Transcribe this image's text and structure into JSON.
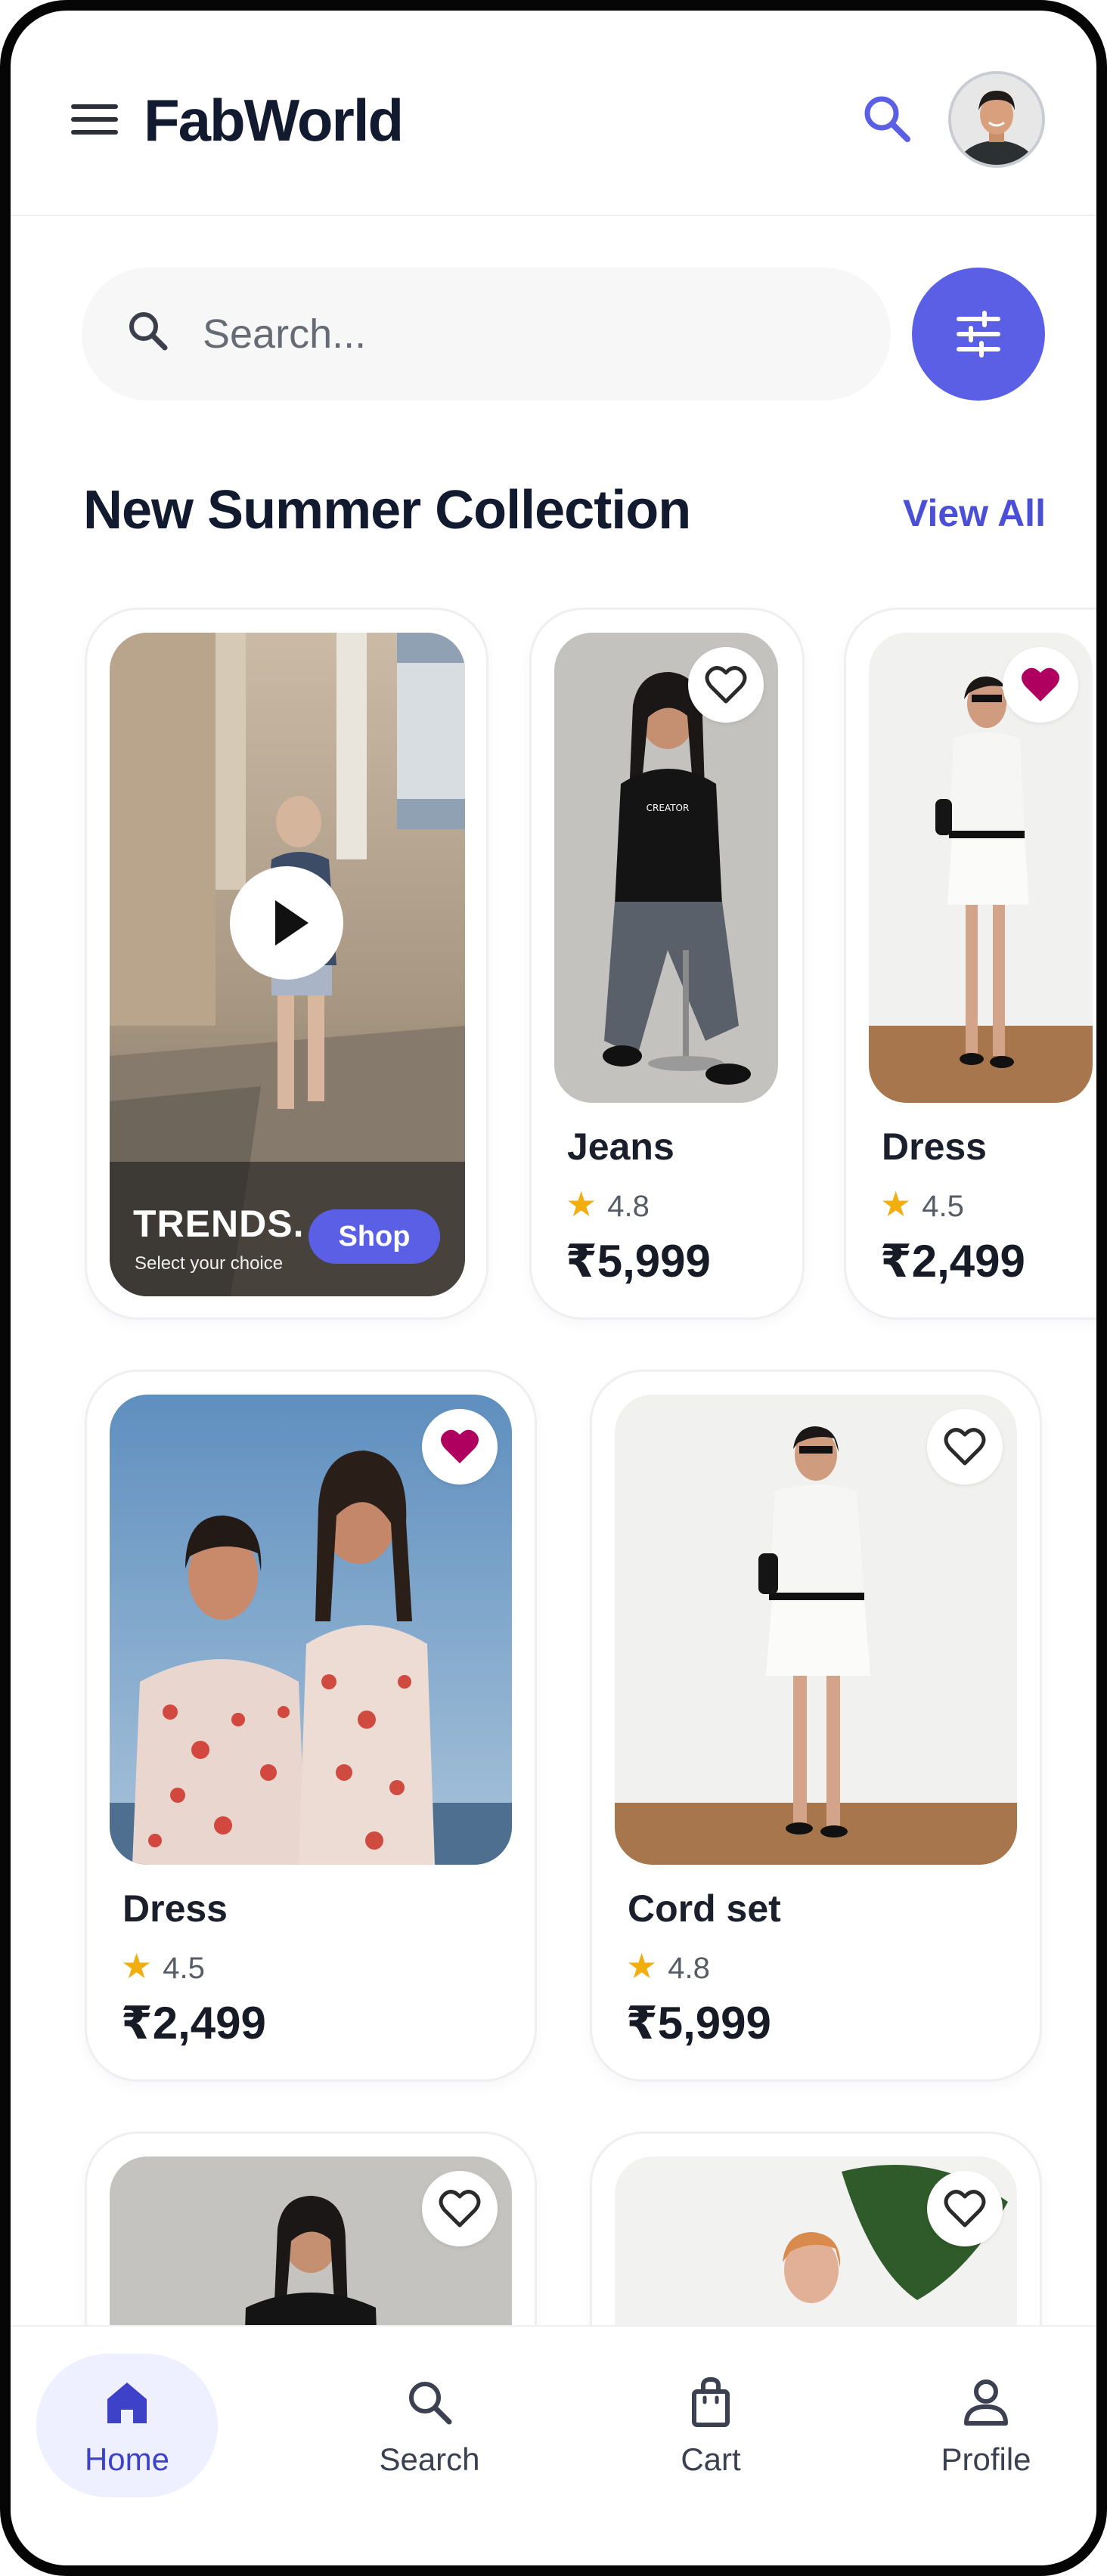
{
  "header": {
    "app_title": "FabWorld"
  },
  "search": {
    "placeholder": "Search..."
  },
  "section": {
    "title": "New Summer Collection",
    "view_all": "View All"
  },
  "featured": {
    "title": "TRENDS.",
    "subtitle": "Select your choice",
    "shop_label": "Shop"
  },
  "products": [
    {
      "name": "Jeans",
      "rating": "4.8",
      "price": "₹5,999",
      "favorited": false
    },
    {
      "name": "Dress",
      "rating": "4.5",
      "price": "₹2,499",
      "favorited": true
    },
    {
      "name": "Dress",
      "rating": "4.5",
      "price": "₹2,499",
      "favorited": true
    },
    {
      "name": "Cord set",
      "rating": "4.8",
      "price": "₹5,999",
      "favorited": false
    },
    {
      "favorited": false
    },
    {
      "favorited": false
    }
  ],
  "nav": {
    "items": [
      {
        "label": "Home",
        "icon": "home-icon",
        "active": true
      },
      {
        "label": "Search",
        "icon": "search-icon",
        "active": false
      },
      {
        "label": "Cart",
        "icon": "bag-icon",
        "active": false
      },
      {
        "label": "Profile",
        "icon": "person-icon",
        "active": false
      }
    ]
  },
  "colors": {
    "accent": "#5b5fe6",
    "heart_active": "#b0005f",
    "star": "#f2ae11",
    "title": "#111a2e"
  }
}
